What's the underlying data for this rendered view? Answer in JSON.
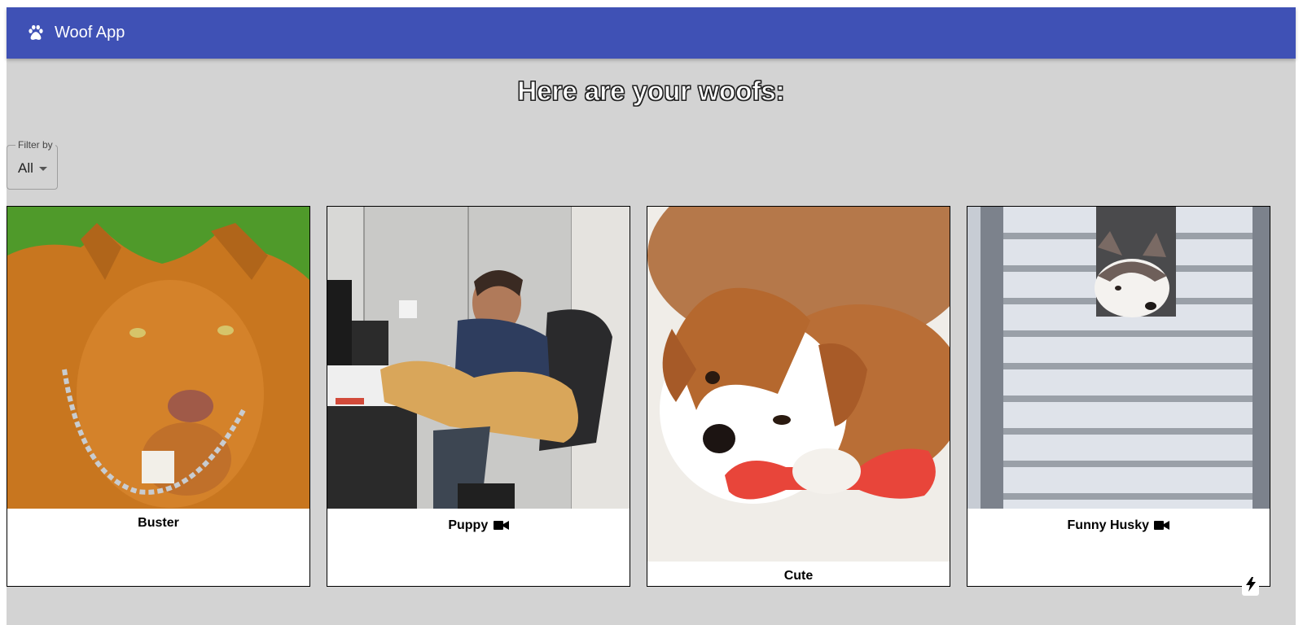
{
  "appbar": {
    "title": "Woof App",
    "icon": "paw-icon",
    "color": "#3f51b5"
  },
  "page": {
    "heading": "Here are your woofs:",
    "background": "#d3d3d3"
  },
  "filter": {
    "label": "Filter by",
    "selected": "All"
  },
  "cards": [
    {
      "caption": "Buster",
      "video": false,
      "image": "orange pit bull with chain collar on grass"
    },
    {
      "caption": "Puppy",
      "video": true,
      "image": "man at desk with golden retriever on lap"
    },
    {
      "caption": "Cute",
      "video": false,
      "image": "brown and white puppy chewing red toy bone"
    },
    {
      "caption": "Funny Husky",
      "video": true,
      "image": "husky peeking through white fence slats"
    }
  ],
  "corner_button": {
    "icon": "lightning-bolt-icon"
  }
}
